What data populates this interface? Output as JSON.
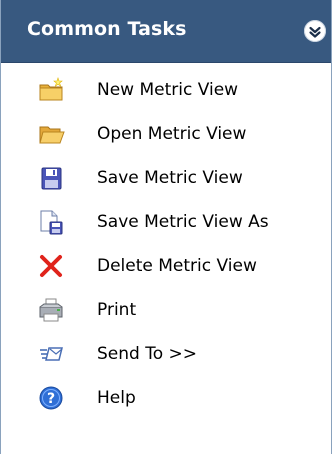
{
  "panel": {
    "title": "Common Tasks",
    "collapse_icon": "double-chevron-up-icon",
    "header_color": "#385980"
  },
  "tasks": [
    {
      "label": "New Metric View",
      "icon": "new-folder-icon"
    },
    {
      "label": "Open Metric View",
      "icon": "open-folder-icon"
    },
    {
      "label": "Save Metric View",
      "icon": "floppy-disk-icon"
    },
    {
      "label": "Save Metric View As",
      "icon": "save-as-icon"
    },
    {
      "label": "Delete Metric View",
      "icon": "red-x-delete-icon"
    },
    {
      "label": "Print",
      "icon": "printer-icon"
    },
    {
      "label": "Send To >>",
      "icon": "send-to-icon"
    },
    {
      "label": "Help",
      "icon": "help-question-icon"
    }
  ]
}
